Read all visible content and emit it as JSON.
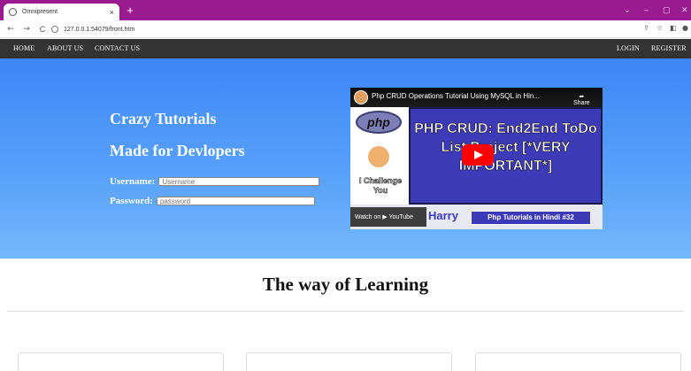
{
  "browser": {
    "tab_title": "Omnipresent",
    "tab_close": "×",
    "new_tab": "+",
    "url": "127.0.0.1:54079/front.htm",
    "back": "←",
    "forward": "→",
    "reload": "C",
    "window_controls": [
      "⌄",
      "–",
      "▢",
      "✕"
    ],
    "frame_color": "#9b1a8f"
  },
  "nav": {
    "left": [
      "HOME",
      "ABOUT US",
      "CONTACT US"
    ],
    "right": [
      "LOGIN",
      "REGISTER"
    ]
  },
  "hero": {
    "heading1": "Crazy Tutorials",
    "heading2": "Made for Devlopers",
    "username_label": "Username:",
    "username_placeholder": "Username",
    "password_label": "Password:",
    "password_placeholder": "password",
    "gradient_top": "#3c86f7",
    "gradient_bottom": "#74b8fc"
  },
  "video": {
    "title": "Php CRUD Operations Tutorial Using MySQL in Hin...",
    "share": "Share",
    "logo_text": "php",
    "challenge": "I Challenge You",
    "headline": "PHP CRUD: End2End ToDo List Project [*VERY IMPORTANT*]",
    "watch_on": "Watch on ▶ YouTube",
    "channel": "Harry",
    "series": "Php Tutorials in Hindi #32"
  },
  "section": {
    "title": "The way of Learning"
  }
}
